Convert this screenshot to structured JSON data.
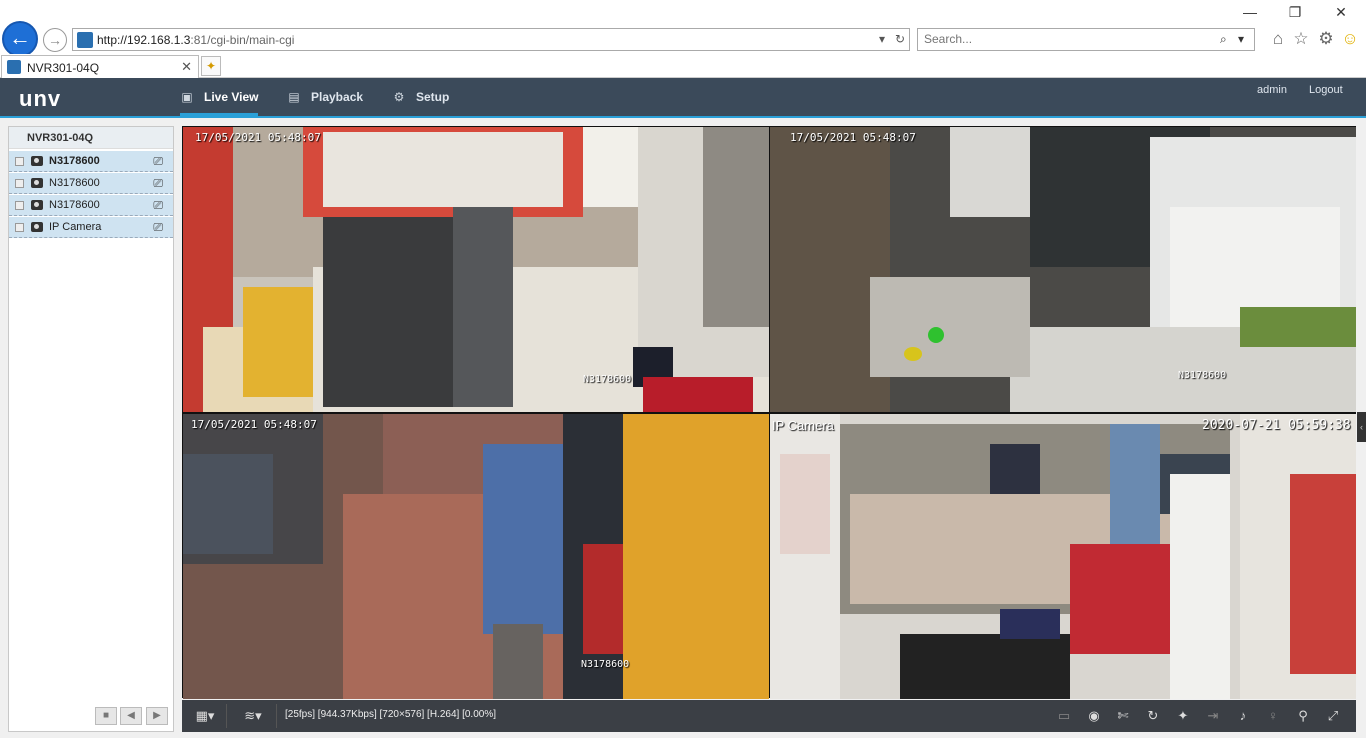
{
  "browser": {
    "url_host": "http://192.168.1.3",
    "url_port": ":81",
    "url_path": "/cgi-bin/main-cgi",
    "search_placeholder": "Search...",
    "tab_title": "NVR301-04Q"
  },
  "header": {
    "logo": "unv",
    "menu": [
      {
        "label": "Live View",
        "icon": "monitor-icon"
      },
      {
        "label": "Playback",
        "icon": "film-icon"
      },
      {
        "label": "Setup",
        "icon": "gear-icon"
      }
    ],
    "user": "admin",
    "logout": "Logout",
    "accent_color": "#2aa0d8"
  },
  "device_tree": {
    "root": "NVR301-04Q",
    "cameras": [
      {
        "name": "N3178600"
      },
      {
        "name": "N3178600"
      },
      {
        "name": "N3178600"
      },
      {
        "name": "IP Camera"
      }
    ]
  },
  "video": {
    "tiles": [
      {
        "timestamp": "17/05/2021 05:48:07",
        "camera_name": "N3178600"
      },
      {
        "timestamp": "17/05/2021 05:48:07",
        "camera_name": "N3178600"
      },
      {
        "timestamp": "17/05/2021 05:48:07",
        "camera_name": "N3178600"
      },
      {
        "timestamp": "2020-07-21 05:59:38",
        "camera_name": "IP Camera"
      }
    ]
  },
  "toolbar": {
    "stats": "[25fps] [944.37Kbps] [720×576] [H.264] [0.00%]"
  }
}
